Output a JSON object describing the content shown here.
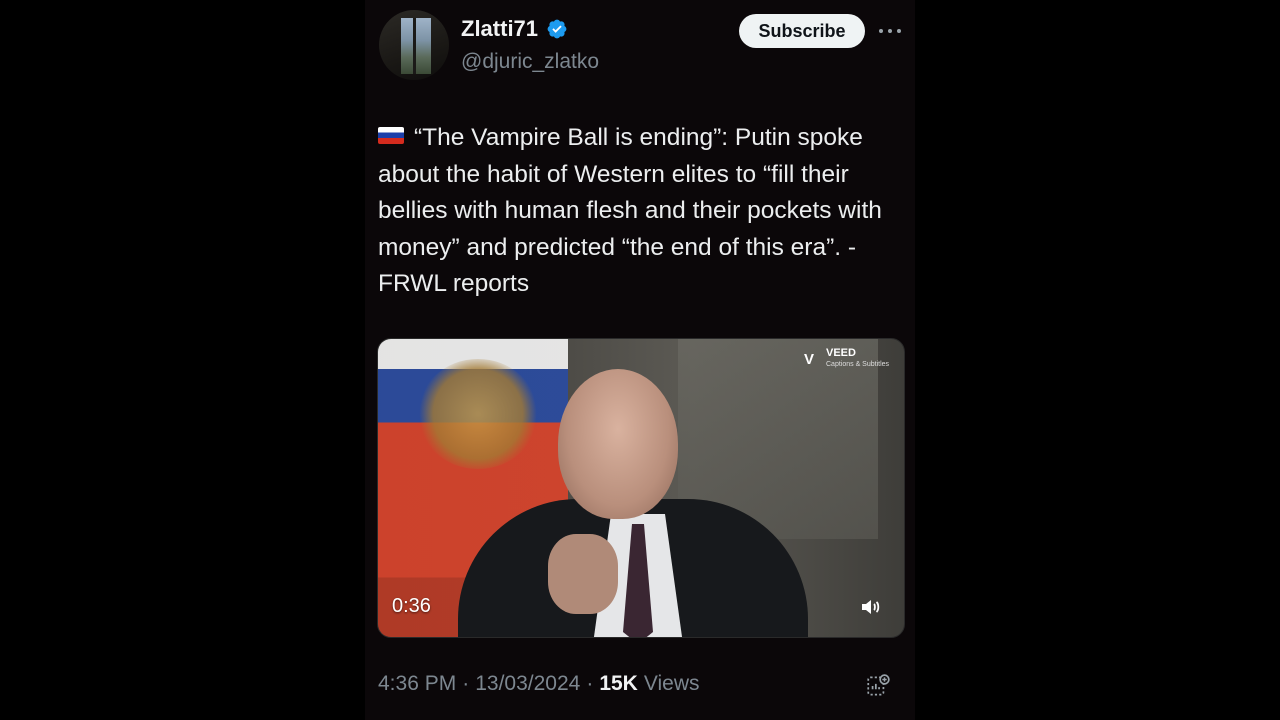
{
  "header": {
    "display_name": "Zlatti71",
    "handle": "@djuric_zlatko",
    "subscribe_label": "Subscribe"
  },
  "tweet": {
    "flag_icon": "russia-flag-icon",
    "text": "“The Vampire Ball is ending”: Putin spoke about the habit of Western elites to “fill their bellies with human flesh and their pockets with money” and predicted “the end of this era”. - FRWL reports"
  },
  "video": {
    "duration": "0:36",
    "watermark": "VEED",
    "watermark_sub": "Captions & Subtitles"
  },
  "meta": {
    "time": "4:36 PM",
    "separator": "·",
    "date": "13/03/2024",
    "views_count": "15K",
    "views_label": "Views"
  },
  "colors": {
    "background": "#000000",
    "card": "#0b0709",
    "verified": "#1d9bf0",
    "subscribe_bg": "#eff3f4",
    "muted_text": "#7d8790"
  }
}
